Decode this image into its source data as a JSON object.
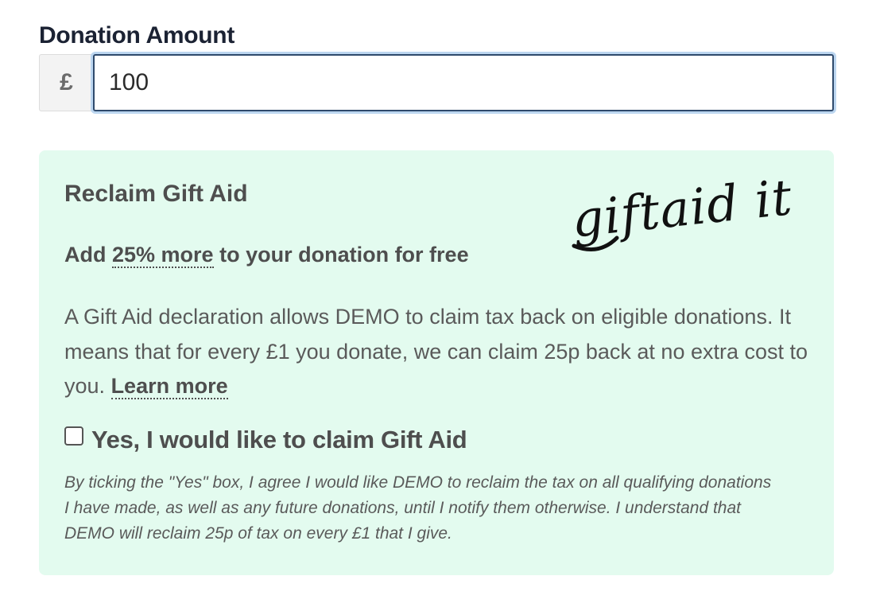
{
  "donation": {
    "label": "Donation Amount",
    "currency_symbol": "£",
    "amount_value": "100"
  },
  "gift_aid": {
    "title": "Reclaim Gift Aid",
    "logo_text": "giftaid it",
    "subtitle_prefix": "Add",
    "subtitle_highlight": "25% more",
    "subtitle_suffix": "to your donation for free",
    "body_text": "A Gift Aid declaration allows DEMO to claim tax back on eligible donations. It means that for every £1 you donate, we can claim 25p back at no extra cost to you.",
    "learn_more_label": "Learn more",
    "checkbox_label": "Yes, I would like to claim Gift Aid",
    "checkbox_checked": false,
    "disclaimer": "By ticking the \"Yes\" box, I agree I would like DEMO to reclaim the tax on all qualifying donations I have made, as well as any future donations, until I notify them otherwise. I understand that DEMO will reclaim 25p of tax on every £1 that I give."
  },
  "colors": {
    "panel_background": "#e3fbef",
    "input_border": "#2f4a6c",
    "focus_ring": "#bcd6f0",
    "text_dark": "#1b2233",
    "text_muted": "#4e4e4e"
  }
}
